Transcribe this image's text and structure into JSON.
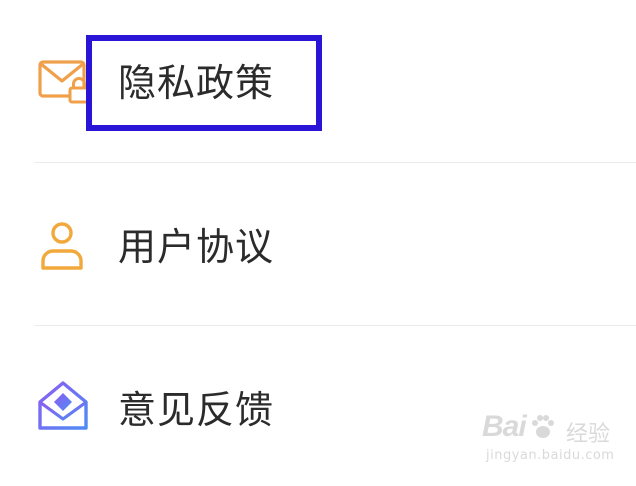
{
  "menu": {
    "items": [
      {
        "label": "隐私政策",
        "icon": "envelope-lock-icon"
      },
      {
        "label": "用户协议",
        "icon": "user-icon"
      },
      {
        "label": "意见反馈",
        "icon": "open-envelope-icon"
      }
    ]
  },
  "highlight": {
    "target": "privacy-policy",
    "color": "#2a14d6"
  },
  "colors": {
    "envelope_lock": "#f0a04a",
    "user": "#f2a93b",
    "feedback_start": "#8c5cf0",
    "feedback_end": "#4f8bf5",
    "label": "#2b2b2b",
    "divider": "#ececec"
  },
  "watermark": {
    "brand": "Bai",
    "brand_suffix": "经验",
    "domain": "jingyan.baidu.com"
  }
}
